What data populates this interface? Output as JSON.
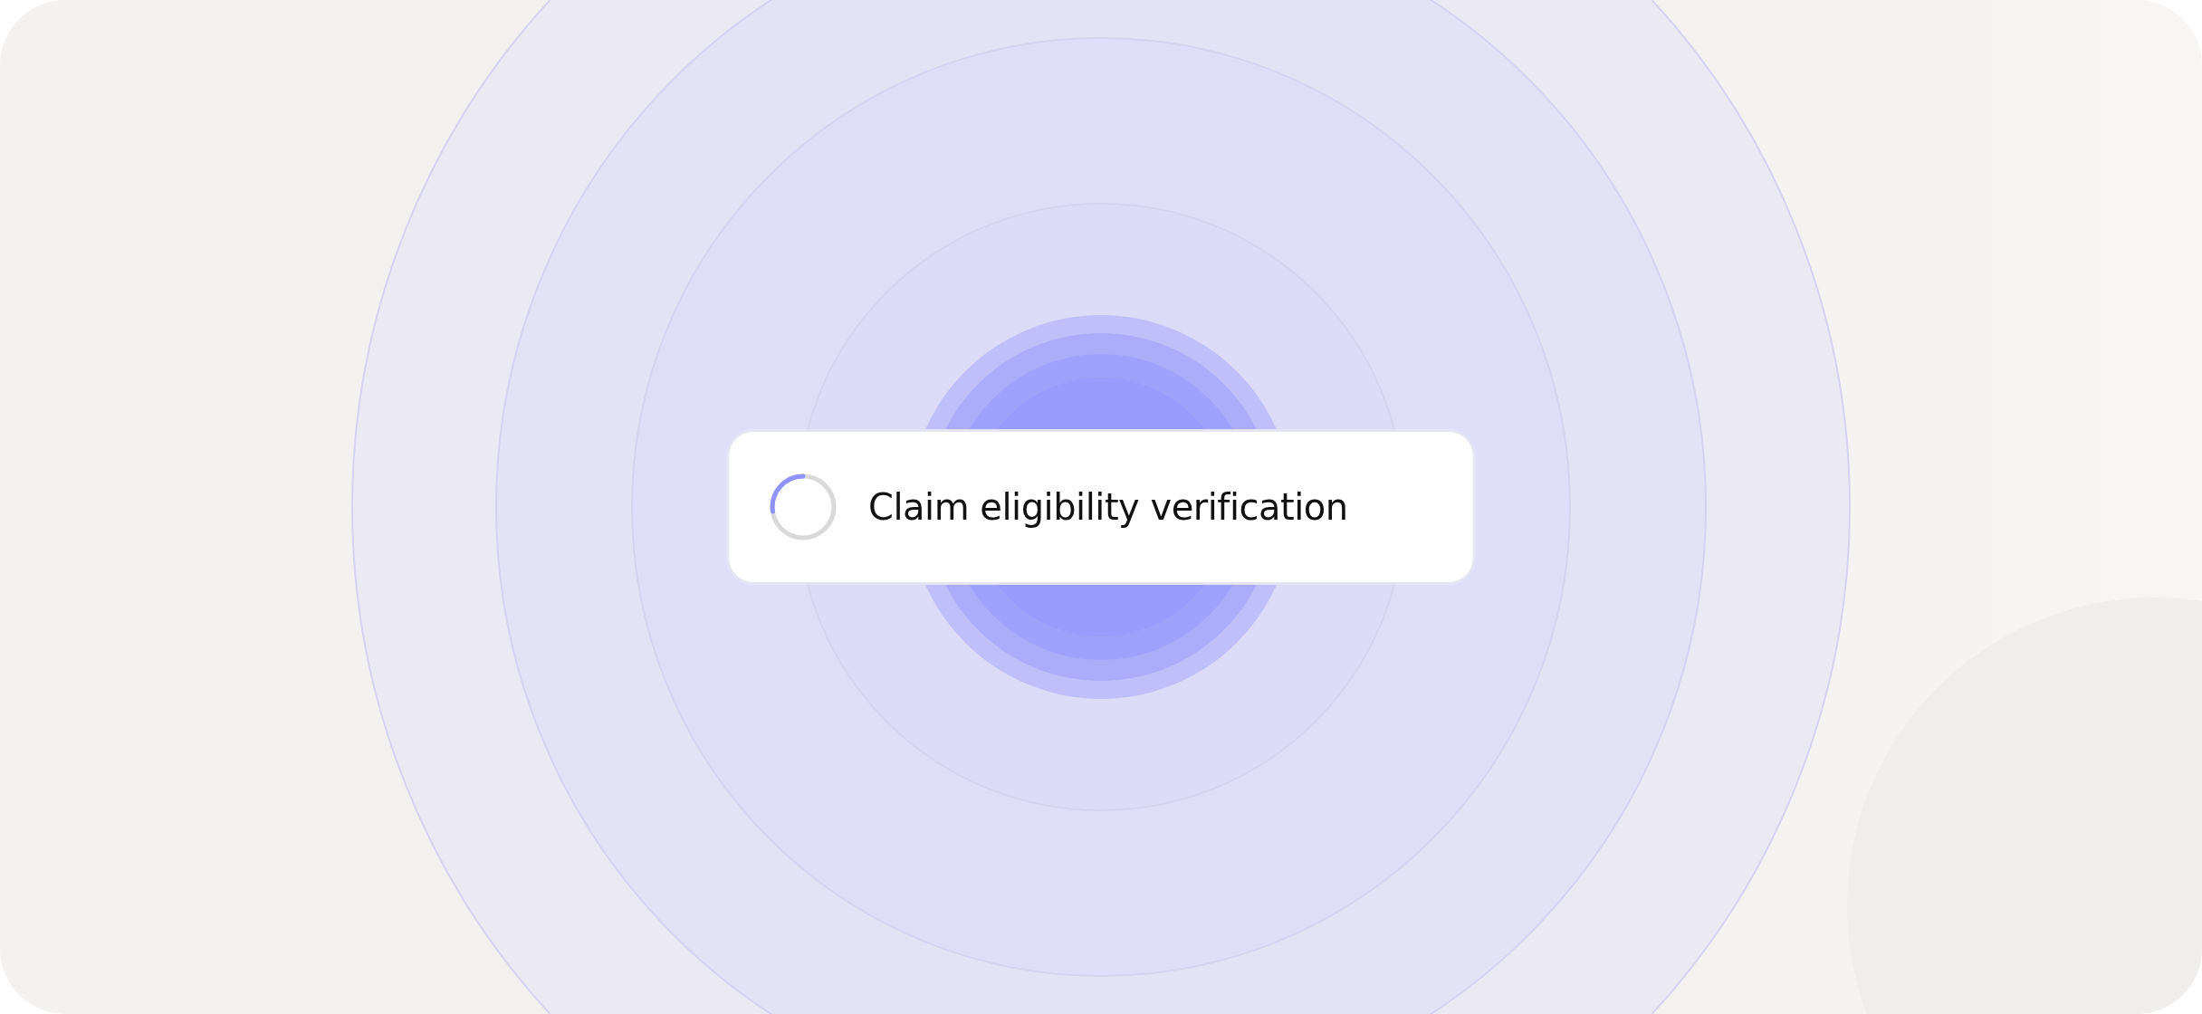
{
  "card": {
    "label": "Claim eligibility verification"
  }
}
